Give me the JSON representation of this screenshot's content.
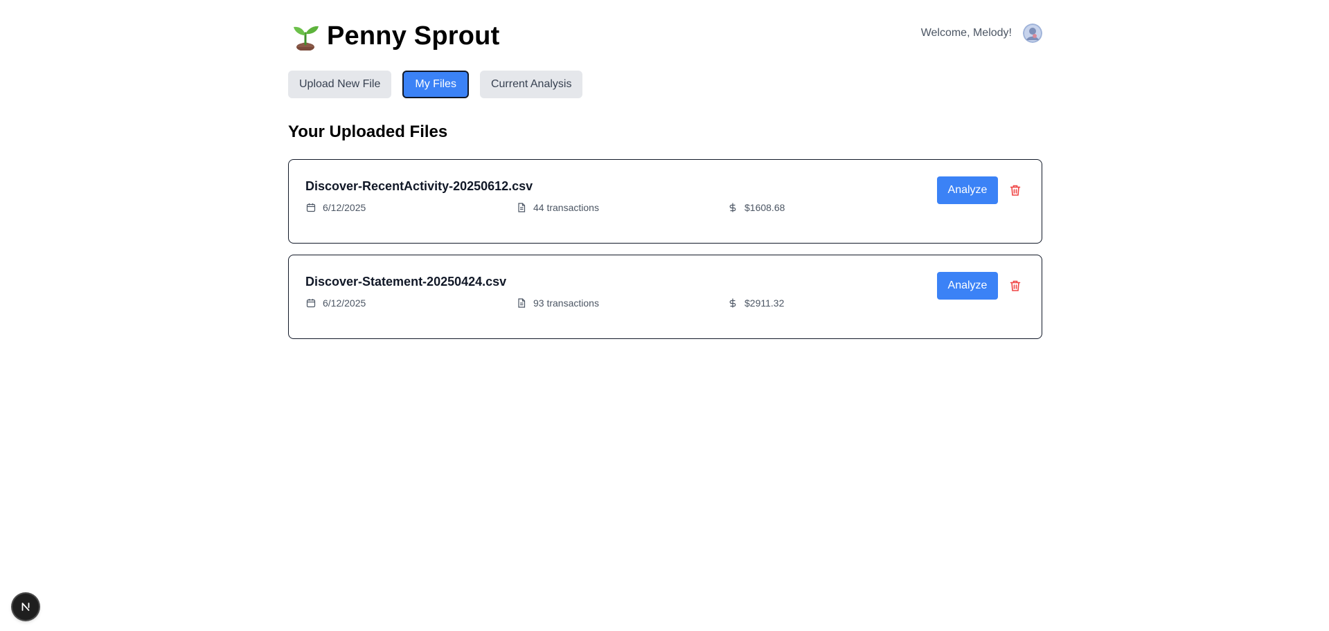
{
  "app": {
    "title": "Penny Sprout",
    "logo_icon": "seedling-icon"
  },
  "user": {
    "welcome": "Welcome, Melody!",
    "avatar_icon": "avatar"
  },
  "tabs": [
    {
      "label": "Upload New File",
      "active": false
    },
    {
      "label": "My Files",
      "active": true
    },
    {
      "label": "Current Analysis",
      "active": false
    }
  ],
  "section": {
    "title": "Your Uploaded Files"
  },
  "files": [
    {
      "name": "Discover-RecentActivity-20250612.csv",
      "date": "6/12/2025",
      "transactions": "44 transactions",
      "amount": "$1608.68",
      "analyze_label": "Analyze"
    },
    {
      "name": "Discover-Statement-20250424.csv",
      "date": "6/12/2025",
      "transactions": "93 transactions",
      "amount": "$2911.32",
      "analyze_label": "Analyze"
    }
  ],
  "colors": {
    "accent": "#3b82f6",
    "tab_inactive": "#e5e7eb",
    "danger": "#ef4444"
  },
  "dev_badge": {
    "letter": "N"
  }
}
